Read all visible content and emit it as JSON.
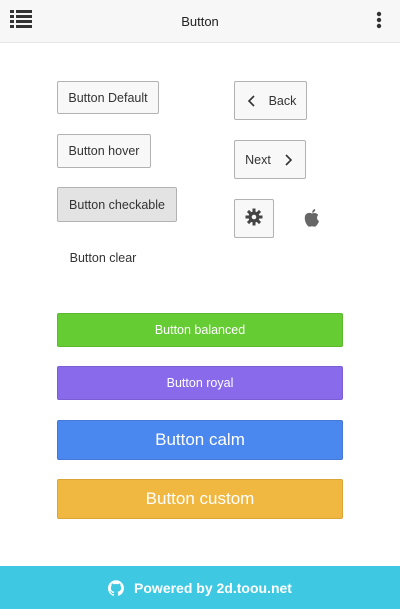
{
  "header": {
    "title": "Button",
    "menu_icon": "list-icon",
    "more_icon": "kebab-icon"
  },
  "buttons": {
    "default_label": "Button Default",
    "hover_label": "Button hover",
    "checkable_label": "Button checkable",
    "clear_label": "Button clear",
    "back_label": "Back",
    "next_label": "Next",
    "gear_icon": "gear-icon",
    "apple_icon": "apple-icon",
    "balanced_label": "Button balanced",
    "royal_label": "Button royal",
    "calm_label": "Button calm",
    "custom_label": "Button custom"
  },
  "colors": {
    "balanced": "#66cc33",
    "royal": "#886aea",
    "calm": "#4a87ee",
    "custom": "#f0b840",
    "footer": "#3ec8e2"
  },
  "footer": {
    "icon": "github-icon",
    "text": "Powered by 2d.toou.net"
  }
}
